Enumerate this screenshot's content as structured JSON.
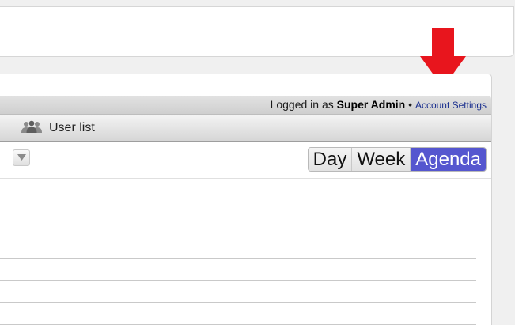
{
  "login": {
    "prefix": "Logged in as",
    "user": "Super Admin",
    "separator": "•",
    "account_link": "Account Settings"
  },
  "nav": {
    "user_list_label": "User list",
    "user_list_icon": "users-icon"
  },
  "toolbar": {
    "dropdown_icon": "triangle-down-icon",
    "views": [
      {
        "label": "Day",
        "active": false
      },
      {
        "label": "Week",
        "active": false
      },
      {
        "label": "Agenda",
        "active": true
      }
    ]
  },
  "colors": {
    "active_view": "#5556cf",
    "link": "#1a2f8f",
    "annotation_arrow": "#e8151d"
  }
}
